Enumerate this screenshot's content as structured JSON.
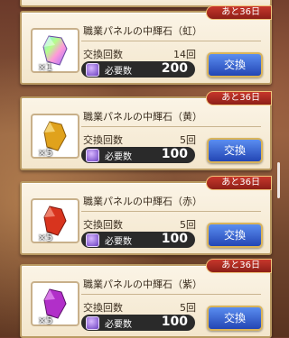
{
  "items": [
    {
      "ribbon": "あと36日",
      "name": "職業パネルの中輝石（虹）",
      "count_label": "×1",
      "exchange_label": "交換回数",
      "exchange_value": "14回",
      "cost_label": "必要数",
      "cost_value": "200",
      "button": "交換",
      "gem_color": "rainbow"
    },
    {
      "ribbon": "あと36日",
      "name": "職業パネルの中輝石（黄）",
      "count_label": "×5",
      "exchange_label": "交換回数",
      "exchange_value": "5回",
      "cost_label": "必要数",
      "cost_value": "100",
      "button": "交換",
      "gem_color": "#e0a21c"
    },
    {
      "ribbon": "あと36日",
      "name": "職業パネルの中輝石（赤）",
      "count_label": "×5",
      "exchange_label": "交換回数",
      "exchange_value": "5回",
      "cost_label": "必要数",
      "cost_value": "100",
      "button": "交換",
      "gem_color": "#d8341e"
    },
    {
      "ribbon": "あと36日",
      "name": "職業パネルの中輝石（紫）",
      "count_label": "×5",
      "exchange_label": "交換回数",
      "exchange_value": "5回",
      "cost_label": "必要数",
      "cost_value": "100",
      "button": "交換",
      "gem_color": "#b12fc9"
    }
  ]
}
